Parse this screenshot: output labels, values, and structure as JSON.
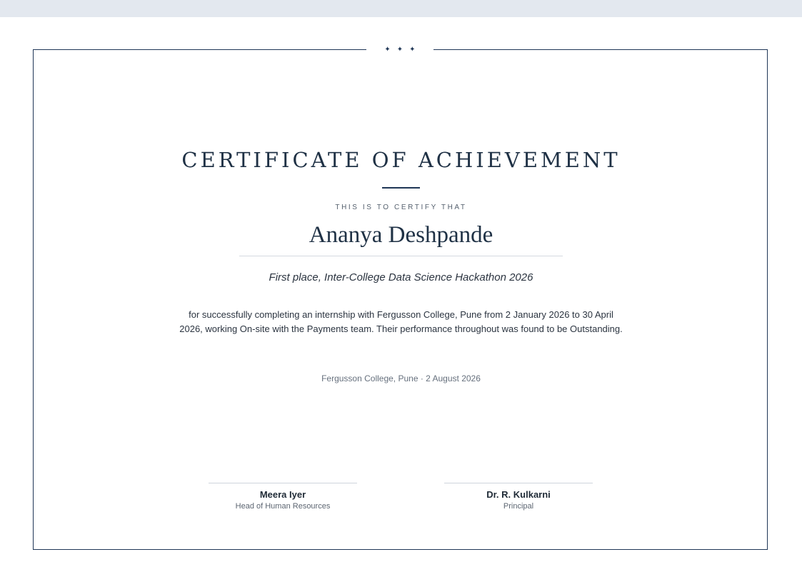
{
  "certificate": {
    "ornament": "✦✦✦",
    "title": "CERTIFICATE OF ACHIEVEMENT",
    "certify_line": "THIS IS TO CERTIFY THAT",
    "recipient_name": "Ananya Deshpande",
    "achievement": "First place, Inter-College Data Science Hackathon 2026",
    "body": "for successfully completing an internship with Fergusson College, Pune from 2 January 2026 to 30 April 2026, working On-site with the Payments team. Their performance throughout was found to be Outstanding.",
    "issuer_date": "Fergusson College, Pune · 2 August 2026"
  },
  "signatories": [
    {
      "name": "Meera Iyer",
      "role": "Head of Human Resources"
    },
    {
      "name": "Dr. R. Kulkarni",
      "role": "Principal"
    }
  ],
  "colors": {
    "frame": "#1f3656",
    "title": "#1f3145",
    "top_strip": "#e3e8ef"
  }
}
